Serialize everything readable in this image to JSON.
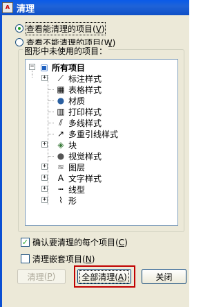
{
  "window": {
    "title": "清理",
    "app_icon_text": "A"
  },
  "radios": [
    {
      "label": "查看能清理的项目",
      "accel": "V",
      "checked": true
    },
    {
      "label": "查看不能清理的项目",
      "accel": "W",
      "checked": false
    }
  ],
  "tree": {
    "group_label": "图形中未使用的项目：",
    "root": {
      "label": "所有项目",
      "icon": "drawing-icon"
    },
    "items": [
      {
        "label": "标注样式",
        "icon": "dimension-style-icon",
        "expandable": true
      },
      {
        "label": "表格样式",
        "icon": "table-style-icon",
        "expandable": false
      },
      {
        "label": "材质",
        "icon": "material-sphere-icon",
        "expandable": false
      },
      {
        "label": "打印样式",
        "icon": "plot-style-icon",
        "expandable": false
      },
      {
        "label": "多线样式",
        "icon": "multiline-style-icon",
        "expandable": false
      },
      {
        "label": "多重引线样式",
        "icon": "multileader-style-icon",
        "expandable": false
      },
      {
        "label": "块",
        "icon": "block-icon",
        "expandable": true
      },
      {
        "label": "视觉样式",
        "icon": "visual-style-icon",
        "expandable": false
      },
      {
        "label": "图层",
        "icon": "layers-icon",
        "expandable": true
      },
      {
        "label": "文字样式",
        "icon": "text-style-icon",
        "expandable": true
      },
      {
        "label": "线型",
        "icon": "linetype-icon",
        "expandable": true
      },
      {
        "label": "形",
        "icon": "shape-icon",
        "expandable": true
      }
    ]
  },
  "checkboxes": [
    {
      "label": "确认要清理的每个项目",
      "accel": "C",
      "checked": true
    },
    {
      "label": "清理嵌套项目",
      "accel": "N",
      "checked": false
    }
  ],
  "buttons": {
    "purge": {
      "label": "清理",
      "accel": "P"
    },
    "purge_all": {
      "label": "全部清理",
      "accel": "A"
    },
    "close": {
      "label": "关闭"
    }
  },
  "colors": {
    "title_bar": "#1f63d8",
    "dialog_bg": "#ece9d8",
    "highlight": "#c00000",
    "check": "#21a121"
  }
}
